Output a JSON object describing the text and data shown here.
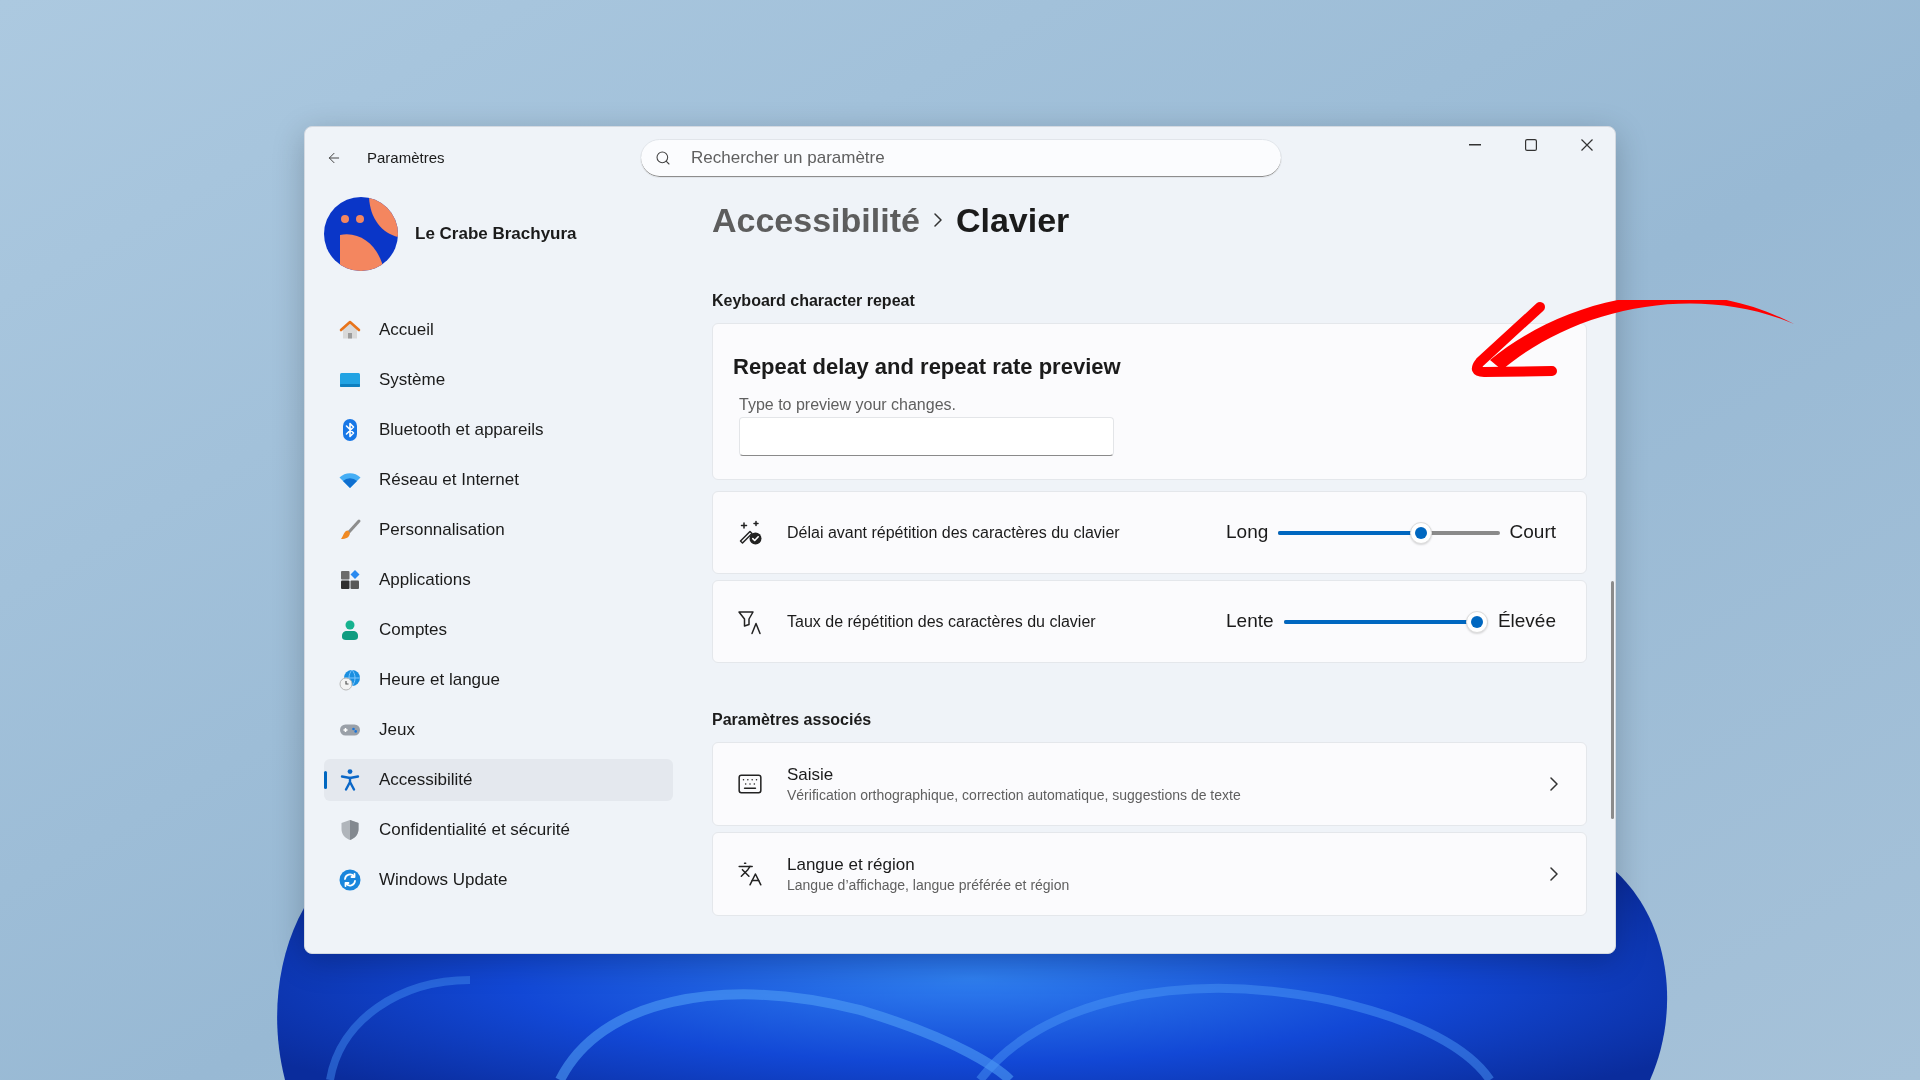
{
  "window": {
    "title": "Paramètres"
  },
  "search": {
    "placeholder": "Rechercher un paramètre"
  },
  "profile": {
    "name": "Le Crabe Brachyura"
  },
  "sidebar": {
    "items": [
      {
        "label": "Accueil",
        "selected": false
      },
      {
        "label": "Système",
        "selected": false
      },
      {
        "label": "Bluetooth et appareils",
        "selected": false
      },
      {
        "label": "Réseau et Internet",
        "selected": false
      },
      {
        "label": "Personnalisation",
        "selected": false
      },
      {
        "label": "Applications",
        "selected": false
      },
      {
        "label": "Comptes",
        "selected": false
      },
      {
        "label": "Heure et langue",
        "selected": false
      },
      {
        "label": "Jeux",
        "selected": false
      },
      {
        "label": "Accessibilité",
        "selected": true
      },
      {
        "label": "Confidentialité et sécurité",
        "selected": false
      },
      {
        "label": "Windows Update",
        "selected": false
      }
    ]
  },
  "breadcrumb": {
    "parent": "Accessibilité",
    "current": "Clavier"
  },
  "sections": [
    {
      "heading": "Keyboard character repeat",
      "cards": [
        {
          "kind": "preview",
          "title": "Repeat delay and repeat rate preview",
          "field_label": "Type to preview your changes."
        },
        {
          "kind": "slider",
          "label": "Délai avant répétition des caractères du clavier",
          "min_label": "Long",
          "max_label": "Court",
          "level": 0.66
        },
        {
          "kind": "slider",
          "label": "Taux de répétition des caractères du clavier",
          "min_label": "Lente",
          "max_label": "Élevée",
          "level": 1
        }
      ]
    },
    {
      "heading": "Paramètres associés",
      "cards": [
        {
          "kind": "link",
          "title": "Saisie",
          "description": "Vérification orthographique, correction automatique, suggestions de texte"
        },
        {
          "kind": "link",
          "title": "Langue et région",
          "description": "Langue d’affichage, langue préférée et région"
        }
      ]
    }
  ]
}
